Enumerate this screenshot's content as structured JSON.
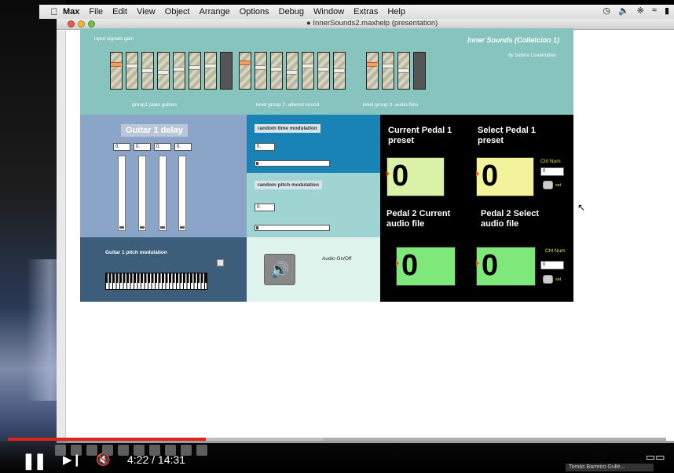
{
  "menubar": {
    "items": [
      "Max",
      "File",
      "Edit",
      "View",
      "Object",
      "Arrange",
      "Options",
      "Debug",
      "Window",
      "Extras",
      "Help"
    ],
    "right_icons": [
      "clock-icon",
      "volume-icon",
      "bluetooth-icon",
      "wifi-icon",
      "battery-icon"
    ]
  },
  "window": {
    "title": "InnerSounds2.maxhelp (presentation)"
  },
  "patch": {
    "input_gain_label": "input signals gain",
    "main_title": "Inner Sounds (Colletcion 1)",
    "author": "by Sabina Covarrubias",
    "group1_label": "group1 plain guitars",
    "group2_label": "level group 2. altered sound",
    "group3_label": "level group 3. audio files",
    "delay": {
      "title": "Guitar 1  delay",
      "numbers": [
        "0.",
        "0.",
        "0.",
        "0."
      ]
    },
    "random_time": {
      "label": "random time modulation",
      "value": "0."
    },
    "random_pitch": {
      "label": "random pitch modulation",
      "value": "0."
    },
    "pitch_mod": {
      "label": "Guitar 1  pitch modulation"
    },
    "audio": {
      "label": "Audio On/Off"
    },
    "pedal": {
      "current_preset_label": "Current Pedal 1 preset",
      "select_preset_label": "Select Pedal 1 preset",
      "current_audio_label": "Pedal 2 Current audio file",
      "select_audio_label": "Pedal 2 Select audio file",
      "current_preset_value": "0",
      "select_preset_value": "0",
      "current_audio_value": "0",
      "select_audio_value": "0",
      "ctrl_num_label": "Ctrl Num",
      "ctrl_num_value_1": "0",
      "ctrl_num_value_2": "0",
      "set_label": "set"
    }
  },
  "player": {
    "time": "4:22 / 14:31",
    "progress_fraction": 0.301,
    "buffered_fraction": 0.478,
    "taskbar_text": "Tomás Barreiro Gulle..."
  },
  "colors": {
    "accent_red": "#d8261f",
    "patch_teal": "#86c4bd",
    "panel_blue": "#1a83b6",
    "pedal_bg": "#000000"
  }
}
